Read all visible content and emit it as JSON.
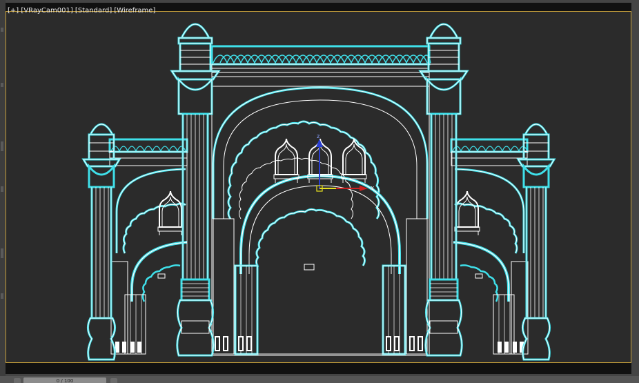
{
  "viewport": {
    "label_parts": [
      "[+]",
      "[VRayCam001]",
      "[Standard]",
      "[Wireframe]"
    ],
    "border_color": "#c9a23a",
    "background": "#2b2b2b",
    "wire_colors": {
      "outline": "#3fe0ea",
      "lines": "#ffffff"
    }
  },
  "gizmo": {
    "x_label": "x",
    "z_label": "z"
  },
  "timeslider": {
    "label": "0 / 100"
  }
}
